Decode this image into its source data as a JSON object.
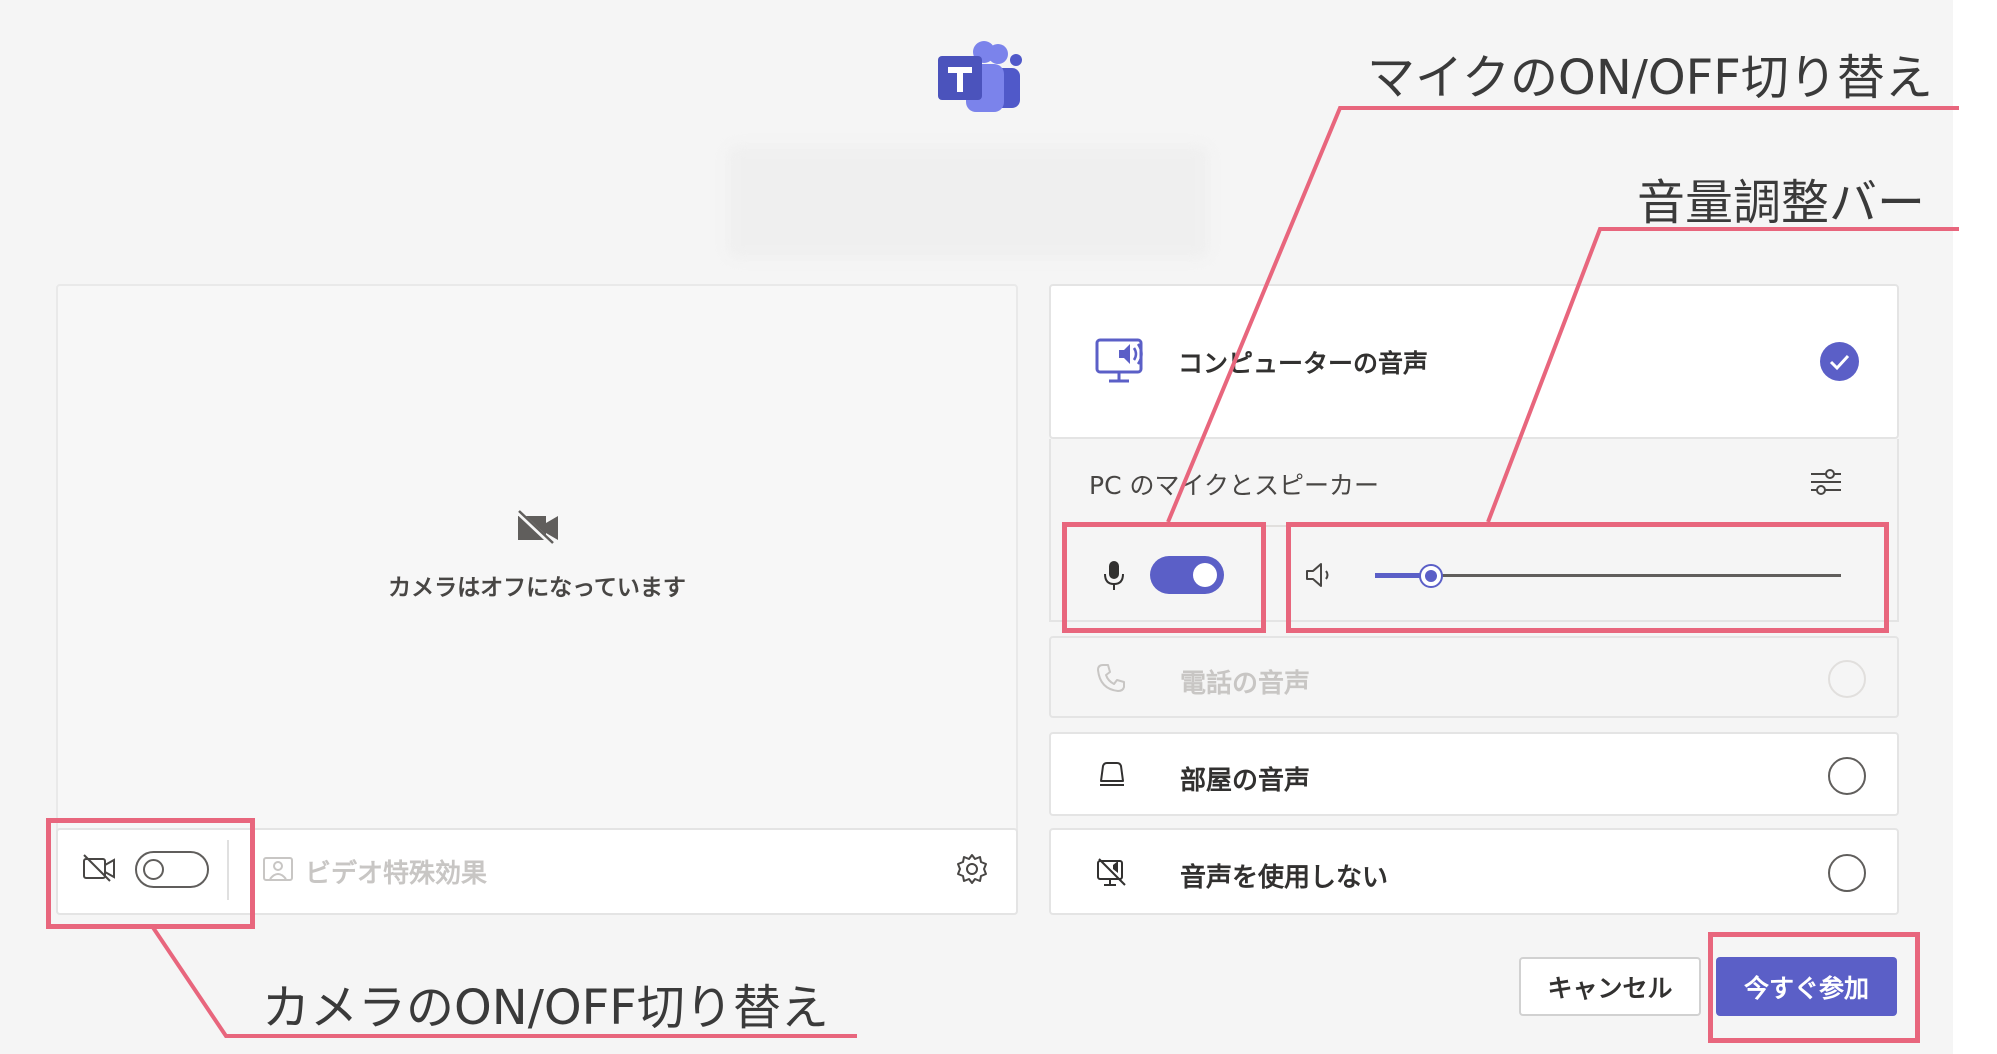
{
  "preview": {
    "camera_off_text": "カメラはオフになっています",
    "effects_label": "ビデオ特殊効果",
    "camera_on": false
  },
  "audio": {
    "computer_audio_label": "コンピューターの音声",
    "device_label": "PC のマイクとスピーカー",
    "mic_on": true,
    "volume_level": 0.12,
    "options": [
      {
        "label": "電話の音声",
        "disabled": true,
        "selected": false
      },
      {
        "label": "部屋の音声",
        "disabled": false,
        "selected": false
      },
      {
        "label": "音声を使用しない",
        "disabled": false,
        "selected": false
      }
    ]
  },
  "buttons": {
    "cancel": "キャンセル",
    "join": "今すぐ参加"
  },
  "annotations": {
    "mic_toggle": "マイクのON/OFF切り替え",
    "volume_bar": "音量調整バー",
    "camera_toggle": "カメラのON/OFF切り替え"
  },
  "colors": {
    "accent": "#5b5fc7",
    "callout": "#e8667d"
  }
}
